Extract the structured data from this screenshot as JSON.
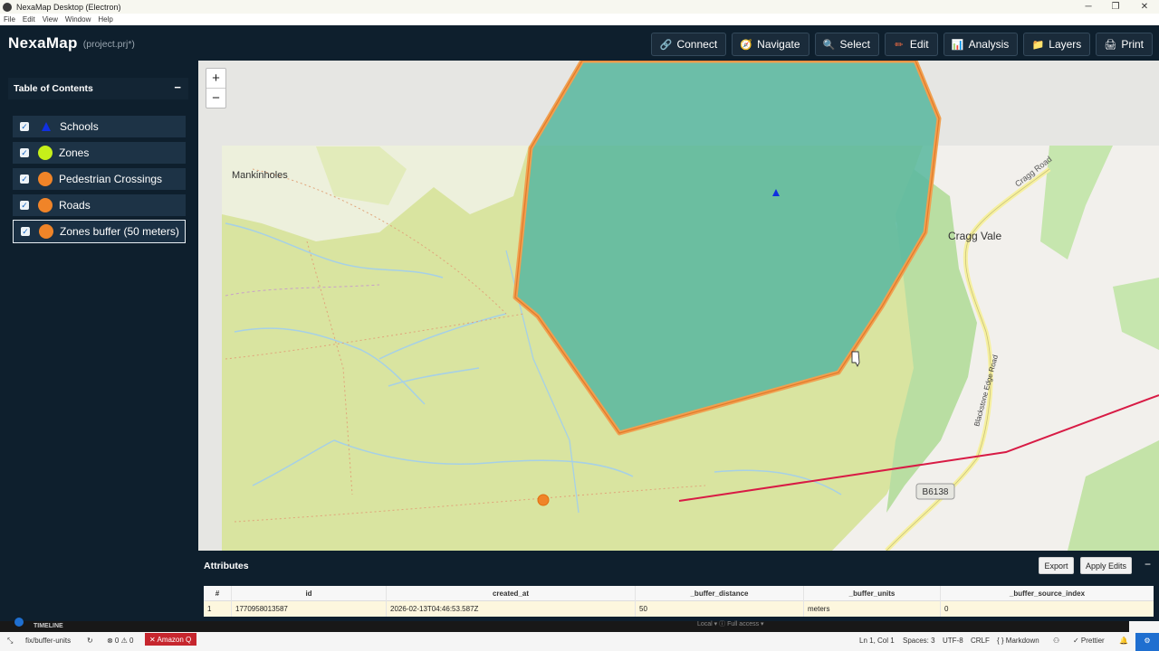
{
  "window": {
    "title": "NexaMap Desktop (Electron)",
    "controls": [
      "─",
      "❐",
      "✕"
    ]
  },
  "menu": [
    "File",
    "Edit",
    "View",
    "Window",
    "Help"
  ],
  "header": {
    "brand": "NexaMap",
    "project": "(project.prj*)",
    "toolbar": [
      {
        "label": "Connect",
        "icon": "link-icon",
        "glyph": "🔗"
      },
      {
        "label": "Navigate",
        "icon": "compass-icon",
        "glyph": "🧭"
      },
      {
        "label": "Select",
        "icon": "magnifier-icon",
        "glyph": "🔍"
      },
      {
        "label": "Edit",
        "icon": "pencil-icon",
        "glyph": "✏"
      },
      {
        "label": "Analysis",
        "icon": "bar-chart-icon",
        "glyph": "📊"
      },
      {
        "label": "Layers",
        "icon": "folder-icon",
        "glyph": "📁"
      },
      {
        "label": "Print",
        "icon": "printer-icon",
        "glyph": "🖨"
      }
    ]
  },
  "toc": {
    "title": "Table of Contents",
    "collapse": "−",
    "layers": [
      {
        "name": "Schools",
        "checked": true,
        "symbol": "triangle",
        "color": "#1030e0"
      },
      {
        "name": "Zones",
        "checked": true,
        "symbol": "circle",
        "color": "#c6ef1a"
      },
      {
        "name": "Pedestrian Crossings",
        "checked": true,
        "symbol": "circle",
        "color": "#f08428"
      },
      {
        "name": "Roads",
        "checked": true,
        "symbol": "circle",
        "color": "#f08428"
      },
      {
        "name": "Zones buffer (50 meters)",
        "checked": true,
        "symbol": "circle",
        "color": "#f08428",
        "selected": true
      }
    ]
  },
  "map": {
    "zoom_in": "+",
    "zoom_out": "−",
    "places": [
      "Mankinholes",
      "Cragg Vale",
      "Cragg Road",
      "Blackstone Edge Road",
      "B6138"
    ],
    "colors": {
      "buffer_fill": "#5bb89f",
      "buffer_stroke": "#f0a050",
      "road": "#d81b45",
      "crossing": "#f08428",
      "school": "#1030e0",
      "moor": "#d9e4a0"
    }
  },
  "attributes": {
    "title": "Attributes",
    "export": "Export",
    "apply": "Apply Edits",
    "collapse": "−",
    "columns": [
      "#",
      "id",
      "created_at",
      "_buffer_distance",
      "_buffer_units",
      "_buffer_source_index"
    ],
    "rows": [
      [
        "1",
        "1770958013587",
        "2026-02-13T04:46:53.587Z",
        "50",
        "meters",
        "0"
      ]
    ]
  },
  "editor": {
    "timeline": "TIMELINE",
    "behind_text": "Local ▾    ⓘ Full access ▾",
    "status": {
      "branch": "fix/buffer-units",
      "errors": "⊗ 0 ⚠ 0",
      "amazon_q": "✕ Amazon Q",
      "position": "Ln 1, Col 1",
      "spaces": "Spaces: 3",
      "encoding": "UTF-8",
      "eol": "CRLF",
      "language": "{ } Markdown",
      "prettier": "✓ Prettier"
    }
  }
}
